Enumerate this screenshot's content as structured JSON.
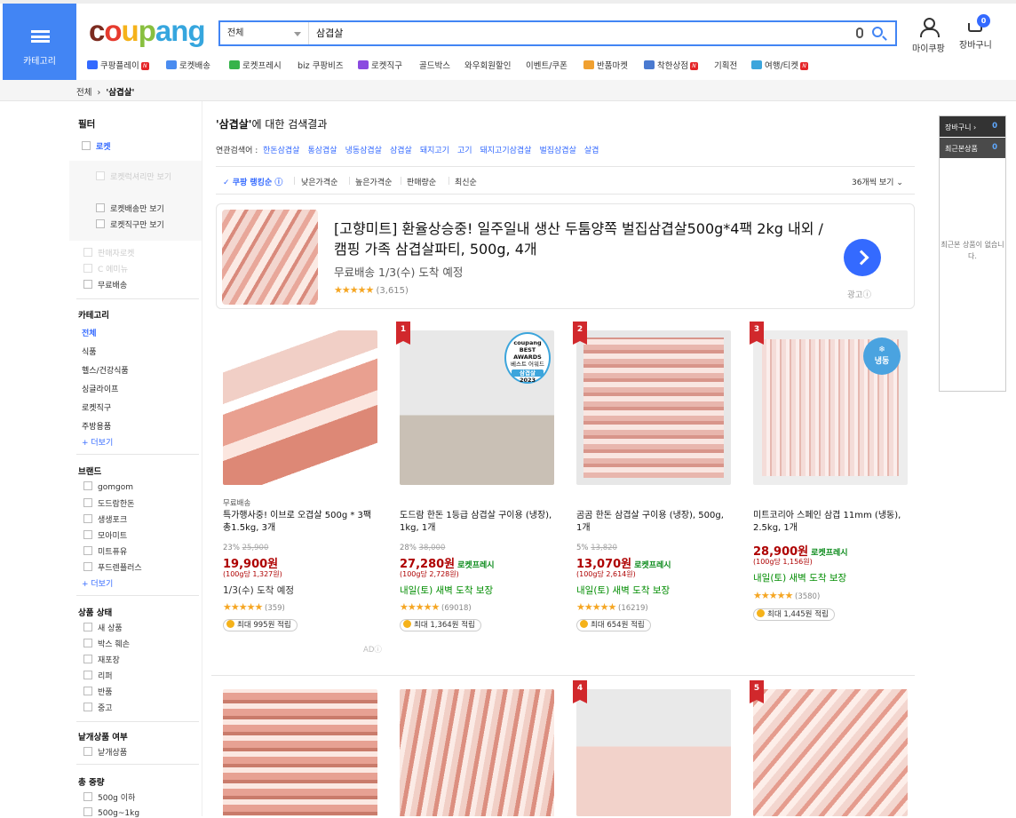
{
  "header": {
    "category_label": "카테고리",
    "logo": [
      "c",
      "o",
      "u",
      "p",
      "ang"
    ],
    "search_scope": "전체",
    "search_query": "삼겹살",
    "mycoupang": "마이쿠팡",
    "cart": "장바구니",
    "cart_count": "0"
  },
  "nav": [
    "쿠팡플레이",
    "로켓배송",
    "로켓프레시",
    "biz 쿠팡비즈",
    "로켓직구",
    "골드박스",
    "와우회원할인",
    "이벤트/쿠폰",
    "반품마켓",
    "착한상점",
    "기획전",
    "여행/티켓"
  ],
  "breadcrumb": {
    "root": "전체",
    "current": "'삼겹살'"
  },
  "sidebar": {
    "filter_title": "필터",
    "rocket": "로켓",
    "rocket_options": [
      "로켓럭셔리만 보기",
      "로켓배송만 보기",
      "로켓직구만 보기"
    ],
    "growth": "판매자로켓",
    "emini": "C 에미뉴",
    "free_ship": "무료배송",
    "category_title": "카테고리",
    "categories": [
      "전체",
      "식품",
      "헬스/건강식품",
      "싱글라이프",
      "로켓직구",
      "주방용품"
    ],
    "more": "+ 더보기",
    "brand_title": "브랜드",
    "brands": [
      "gomgom",
      "도드람한돈",
      "생생포크",
      "모아미트",
      "미트퓨유",
      "푸드렌플러스"
    ],
    "condition_title": "상품 상태",
    "conditions": [
      "새 상품",
      "박스 훼손",
      "재포장",
      "리퍼",
      "반품",
      "중고"
    ],
    "single_title": "낱개상품 여부",
    "single": "낱개상품",
    "weight_title": "총 중량",
    "weights": [
      "500g 이하",
      "500g~1kg"
    ]
  },
  "results": {
    "title_q": "'삼겹살'",
    "title_rest": "에 대한 검색결과",
    "related_label": "연관검색어 :",
    "related": [
      "한돈삼겹살",
      "통삼겹살",
      "냉동삼겹살",
      "삼겹살",
      "돼지고기",
      "고기",
      "돼지고기삼겹살",
      "벌집삼겹살",
      "살겹"
    ],
    "sort": [
      "쿠팡 랭킹순",
      "낮은가격순",
      "높은가격순",
      "판매량순",
      "최신순"
    ],
    "per_page": "36개씩 보기"
  },
  "ad": {
    "title": "[고향미트] 환율상승중! 일주일내 생산 두툼양쪽 벌집삼겹살500g*4팩 2kg 내외 /캠핑 가족 삼겹살파티, 500g, 4개",
    "ship_free": "무료배송",
    "ship_date": "1/3(수) 도착 예정",
    "reviews": "(3,615)",
    "tag": "광고ⓘ"
  },
  "products": [
    {
      "rank": "",
      "sub": "무료배송",
      "name": "특가행사중! 이브로 오겹살 500g * 3팩 총1.5kg, 3개",
      "disc": "23%",
      "orig": "25,900",
      "price": "19,900원",
      "rocket": "",
      "unit": "(100g당 1,327원)",
      "delivery": "1/3(수) 도착 예정",
      "reviews": "(359)",
      "point": "최대 995원 적립"
    },
    {
      "rank": "1",
      "sub": "",
      "name": "도드람 한돈 1등급 삼겹살 구이용 (냉장), 1kg, 1개",
      "disc": "28%",
      "orig": "38,000",
      "price": "27,280원",
      "rocket": "로켓프레시",
      "unit": "(100g당 2,728원)",
      "delivery": "내일(토) 새벽 도착 보장",
      "reviews": "(69018)",
      "point": "최대 1,364원 적립"
    },
    {
      "rank": "2",
      "sub": "",
      "name": "곰곰 한돈 삼겹살 구이용 (냉장), 500g, 1개",
      "disc": "5%",
      "orig": "13,820",
      "price": "13,070원",
      "rocket": "로켓프레시",
      "unit": "(100g당 2,614원)",
      "delivery": "내일(토) 새벽 도착 보장",
      "reviews": "(16219)",
      "point": "최대 654원 적립"
    },
    {
      "rank": "3",
      "sub": "",
      "name": "미트코리아 스페인 삼겹 11mm (냉동), 2.5kg, 1개",
      "disc": "",
      "orig": "",
      "price": "28,900원",
      "rocket": "로켓프레시",
      "unit": "(100g당 1,156원)",
      "delivery": "내일(토) 새벽 도착 보장",
      "reviews": "(3580)",
      "point": "최대 1,445원 적립"
    }
  ],
  "badges": {
    "best_top": "coupang",
    "best_mid": "BEST AWARDS",
    "best_sub": "베스트 어워드",
    "best_cat": "삼겹살",
    "best_year": "2023",
    "frozen": "냉동"
  },
  "row2_ranks": [
    "",
    "",
    "4",
    "5"
  ],
  "ad_small": "ADⓘ",
  "right_panel": {
    "cart": "장바구니 ›",
    "cart_count": "0",
    "recent": "최근본상품",
    "recent_count": "0",
    "empty": "최근본 상품이 없습니다."
  }
}
